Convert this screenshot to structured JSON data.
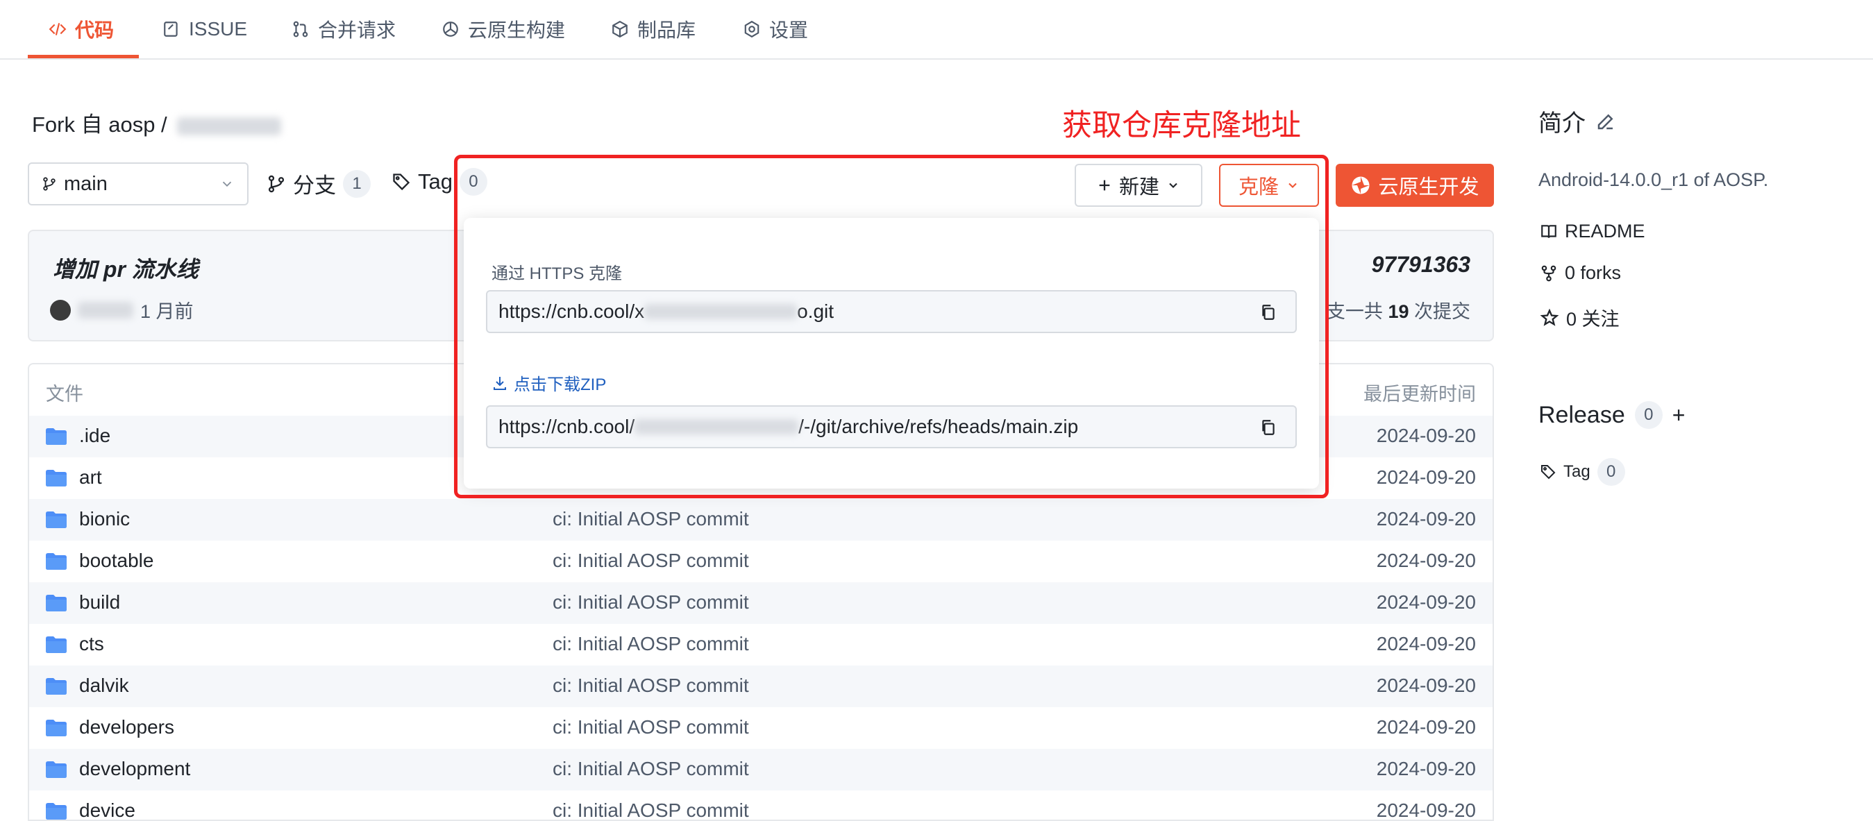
{
  "tabs": [
    {
      "label": "代码",
      "icon": "code-icon"
    },
    {
      "label": "ISSUE",
      "icon": "issue-icon"
    },
    {
      "label": "合并请求",
      "icon": "merge-request-icon"
    },
    {
      "label": "云原生构建",
      "icon": "build-icon"
    },
    {
      "label": "制品库",
      "icon": "package-icon"
    },
    {
      "label": "设置",
      "icon": "settings-icon"
    }
  ],
  "repo": {
    "fork_prefix": "Fork 自 aosp /"
  },
  "annotation": {
    "label": "获取仓库克隆地址",
    "color": "#f02222"
  },
  "toolbar": {
    "branch": "main",
    "branches_label": "分支",
    "branches_count": "1",
    "tags_label": "Tag",
    "tags_count": "0",
    "new_label": "新建",
    "clone_label": "克隆",
    "cloud_dev_label": "云原生开发",
    "accent": "#ee5534"
  },
  "commit": {
    "message": "增加 pr 流水线",
    "time": "1 月前",
    "hash": "97791363",
    "count_prefix": "支一共",
    "count": "19",
    "count_suffix": "次提交"
  },
  "clone_popup": {
    "https_label": "通过 HTTPS 克隆",
    "https_url_start": "https://cnb.cool/x",
    "https_url_end": "o.git",
    "zip_label": "点击下载ZIP",
    "zip_url_start": "https://cnb.cool/",
    "zip_url_end": "/-/git/archive/refs/heads/main.zip"
  },
  "files": {
    "header_name": "文件",
    "header_time": "最后更新时间",
    "rows": [
      {
        "name": ".ide",
        "msg": "",
        "time": "2024-09-20"
      },
      {
        "name": "art",
        "msg": "",
        "time": "2024-09-20"
      },
      {
        "name": "bionic",
        "msg": "ci: Initial AOSP commit",
        "time": "2024-09-20"
      },
      {
        "name": "bootable",
        "msg": "ci: Initial AOSP commit",
        "time": "2024-09-20"
      },
      {
        "name": "build",
        "msg": "ci: Initial AOSP commit",
        "time": "2024-09-20"
      },
      {
        "name": "cts",
        "msg": "ci: Initial AOSP commit",
        "time": "2024-09-20"
      },
      {
        "name": "dalvik",
        "msg": "ci: Initial AOSP commit",
        "time": "2024-09-20"
      },
      {
        "name": "developers",
        "msg": "ci: Initial AOSP commit",
        "time": "2024-09-20"
      },
      {
        "name": "development",
        "msg": "ci: Initial AOSP commit",
        "time": "2024-09-20"
      },
      {
        "name": "device",
        "msg": "ci: Initial AOSP commit",
        "time": "2024-09-20"
      }
    ]
  },
  "sidebar": {
    "intro_title": "简介",
    "description": "Android-14.0.0_r1 of AOSP.",
    "readme": "README",
    "forks": "0 forks",
    "watch": "0 关注",
    "release_title": "Release",
    "release_count": "0",
    "release_add": "+",
    "tag_label": "Tag",
    "tag_count": "0"
  }
}
